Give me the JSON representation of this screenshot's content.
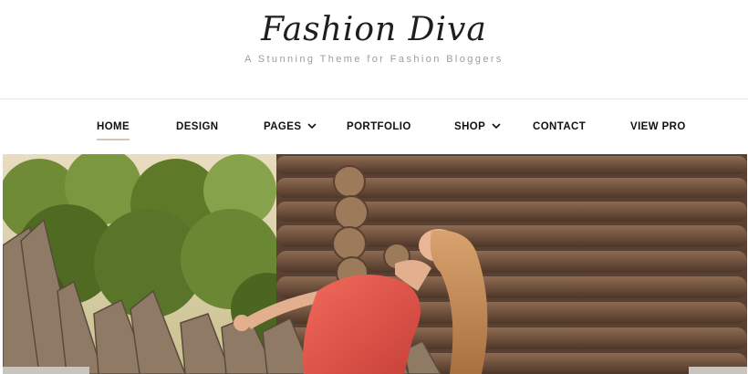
{
  "header": {
    "site_title": "Fashion Diva",
    "tagline": "A Stunning Theme for Fashion Bloggers"
  },
  "nav": {
    "items": [
      {
        "label": "HOME",
        "active": true
      },
      {
        "label": "DESIGN"
      },
      {
        "label": "PAGES",
        "has_dropdown": true
      },
      {
        "label": "PORTFOLIO"
      },
      {
        "label": "SHOP",
        "has_dropdown": true
      },
      {
        "label": "CONTACT"
      },
      {
        "label": "VIEW PRO"
      }
    ],
    "dropdown_icon": "chevron-down-icon"
  },
  "hero": {
    "subject": "Woman in red dress leaning back against a wooden picket fence in front of a log cabin",
    "colors": {
      "cabin": "#7a5a43",
      "foliage": "#5c7b2a",
      "dress": "#e5574a"
    }
  },
  "theme": {
    "accent": "#d7c4ad",
    "text": "#111111",
    "muted": "#9e9e9e"
  }
}
